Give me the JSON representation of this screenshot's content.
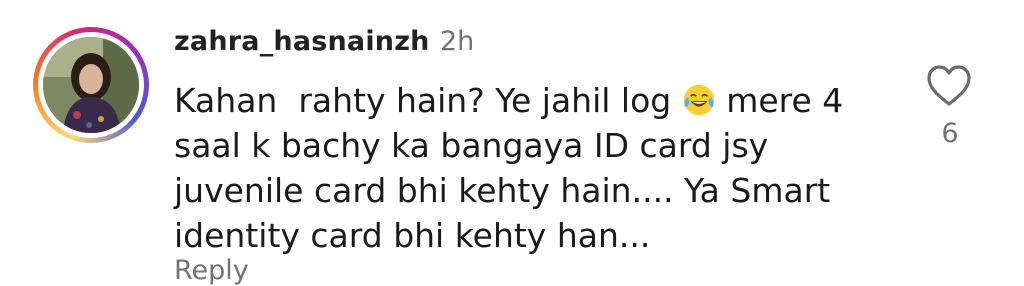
{
  "comment": {
    "username": "zahra_hasnainzh",
    "time": "2h",
    "lines": [
      "Kahan  rahty hain? Ye jahil log",
      "mere 4",
      "saal k bachy ka bangaya ID card jsy",
      "juvenile card bhi kehty hain.... Ya Smart",
      "identity card bhi kehty han..."
    ],
    "emoji_icon": "face-with-tears-of-joy-icon",
    "like_icon": "heart-outline-icon",
    "like_count": "6",
    "reply_label": "Reply"
  }
}
